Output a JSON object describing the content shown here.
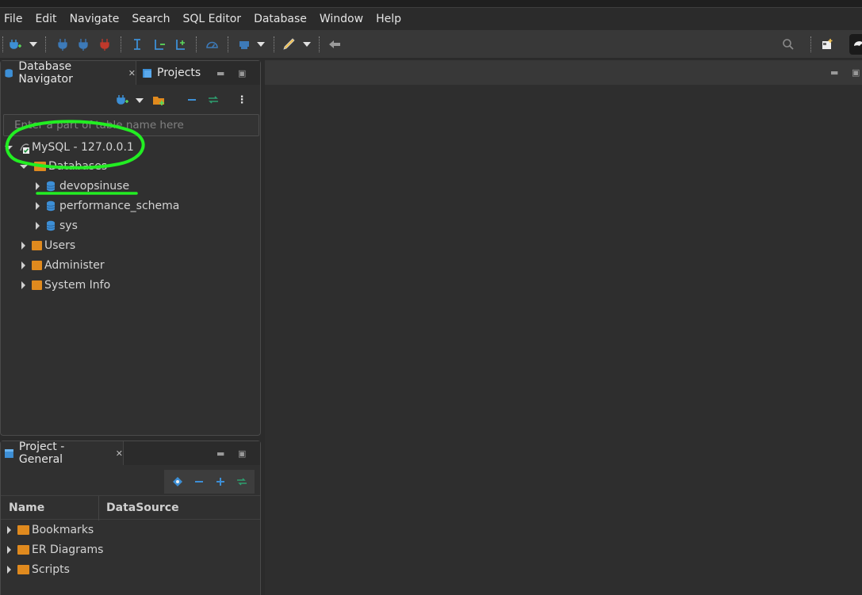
{
  "menu": [
    "File",
    "Edit",
    "Navigate",
    "Search",
    "SQL Editor",
    "Database",
    "Window",
    "Help"
  ],
  "navigator": {
    "tab_active": "Database Navigator",
    "tab_other": "Projects",
    "search_placeholder": "Enter a part of table name here",
    "connection": "MySQL - 127.0.0.1",
    "databases_folder": "Databases",
    "databases": [
      "devopsinuse",
      "performance_schema",
      "sys"
    ],
    "folders": [
      "Users",
      "Administer",
      "System Info"
    ]
  },
  "project": {
    "tab_label": "Project - General",
    "col_name": "Name",
    "col_datasource": "DataSource",
    "items": [
      "Bookmarks",
      "ER Diagrams",
      "Scripts"
    ]
  },
  "colors": {
    "accent_blue": "#3d8fd6",
    "folder_orange": "#e08a1e",
    "annotation_green": "#22ee22"
  }
}
